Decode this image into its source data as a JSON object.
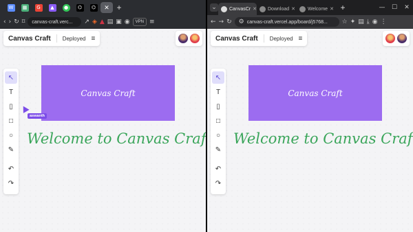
{
  "left_window": {
    "tab_icons": [
      "W",
      "▦",
      "G",
      "▲",
      "●",
      "⌬",
      "⌬"
    ],
    "tab_icon_colors": [
      "#5b8cff",
      "#4caf7a",
      "#ea4335",
      "#8b5cf6",
      "#34c759",
      "#ffffff",
      "#ffffff"
    ],
    "url": "canvas-craft.verc...",
    "vpn": "VPN",
    "cursor_user": "aswanth"
  },
  "right_window": {
    "tabs": [
      {
        "label": "CanvasCr"
      },
      {
        "label": "Download"
      },
      {
        "label": "Welcome"
      }
    ],
    "url": "canvas-craft.vercel.app/board/j5768..."
  },
  "app": {
    "brand": "Canvas Craft",
    "status": "Deployed",
    "menu_icon": "≡",
    "canvas_rect_text": "Canvas Craft",
    "welcome_text": "Welcome to Canvas Craft"
  },
  "tools": [
    {
      "name": "select-tool",
      "glyph": "↖"
    },
    {
      "name": "text-tool",
      "glyph": "T"
    },
    {
      "name": "note-tool",
      "glyph": "▯"
    },
    {
      "name": "rectangle-tool",
      "glyph": "□"
    },
    {
      "name": "ellipse-tool",
      "glyph": "○"
    },
    {
      "name": "pen-tool",
      "glyph": "✎"
    },
    {
      "name": "undo-tool",
      "glyph": "↶"
    },
    {
      "name": "redo-tool",
      "glyph": "↷"
    }
  ],
  "colors": {
    "accent": "#9c6cf0",
    "welcome": "#3aa55a",
    "cursor": "#7c4de8"
  }
}
